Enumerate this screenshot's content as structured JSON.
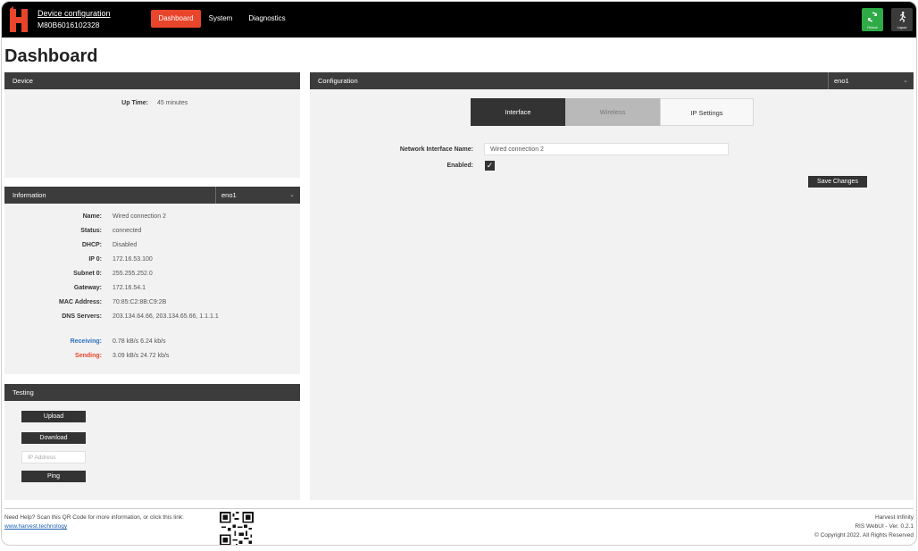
{
  "header": {
    "title": "Device configuration",
    "serial": "M80B6016102328",
    "nav": [
      {
        "label": "Dashboard",
        "active": true
      },
      {
        "label": "System",
        "active": false
      },
      {
        "label": "Diagnostics",
        "active": false
      }
    ],
    "reboot_label": "Reboot",
    "logout_label": "Logout",
    "accent_color": "#e8452b",
    "reboot_color": "#2eaa47"
  },
  "page_title": "Dashboard",
  "device": {
    "heading": "Device",
    "uptime_label": "Up Time:",
    "uptime_value": "45 minutes"
  },
  "information": {
    "heading": "Information",
    "interface_select": "eno1",
    "rows": [
      {
        "label": "Name:",
        "value": "Wired connection 2"
      },
      {
        "label": "Status:",
        "value": "connected"
      },
      {
        "label": "DHCP:",
        "value": "Disabled"
      },
      {
        "label": "IP 0:",
        "value": "172.16.53.100"
      },
      {
        "label": "Subnet 0:",
        "value": "255.255.252.0"
      },
      {
        "label": "Gateway:",
        "value": "172.16.54.1"
      },
      {
        "label": "MAC Address:",
        "value": "70:85:C2:8B:C9:2B"
      },
      {
        "label": "DNS Servers:",
        "value": "203.134.64.66, 203.134.65.66, 1.1.1.1"
      }
    ],
    "receiving_label": "Receiving:",
    "receiving_value": "0.78 kB/s 6.24 kb/s",
    "receiving_color": "#2f6fbf",
    "sending_label": "Sending:",
    "sending_value": "3.09 kB/s 24.72 kb/s",
    "sending_color": "#e8452b"
  },
  "testing": {
    "heading": "Testing",
    "upload_label": "Upload",
    "download_label": "Download",
    "ip_placeholder": "IP Address",
    "ping_label": "Ping"
  },
  "configuration": {
    "heading": "Configuration",
    "interface_select": "eno1",
    "tabs": [
      {
        "label": "Interface",
        "state": "active"
      },
      {
        "label": "Wireless",
        "state": "disabled"
      },
      {
        "label": "IP Settings",
        "state": "normal"
      }
    ],
    "name_label": "Network Interface Name:",
    "name_value": "Wired connection 2",
    "enabled_label": "Enabled:",
    "enabled": true,
    "save_label": "Save Changes"
  },
  "footer": {
    "help_text": "Need Help? Scan this QR Code for more information, or click this link:",
    "link_text": "www.harvest.technology",
    "company": "Harvest Infinity",
    "version": "RIS WebUI - Ver. 0.2.1",
    "copyright": "© Copyright 2022. All Rights Reserved"
  }
}
